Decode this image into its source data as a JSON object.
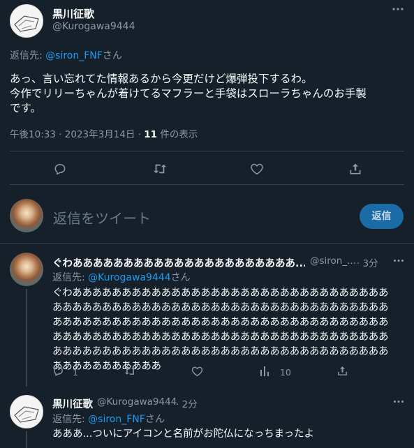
{
  "main_tweet": {
    "display_name": "黒川征歌",
    "handle": "@Kurogawa9444",
    "reply_to_prefix": "返信先: ",
    "reply_to_handle": "@siron_FNF",
    "reply_to_suffix": "さん",
    "text_line1": "あっ、言い忘れてた情報あるから今更だけど爆弾投下するわ。",
    "text_line2": "今作でリリーちゃんが着けてるマフラーと手袋はスローラちゃんのお手製",
    "text_line3": "です。",
    "meta_time": "午後10:33 · 2023年3月14日 · ",
    "meta_views_count": "11",
    "meta_views_label": " 件の表示"
  },
  "compose": {
    "placeholder": "返信をツイート",
    "button_label": "返信"
  },
  "reply1": {
    "display_name": "ぐわああああああああああああああああああああああ...",
    "handle": "@siron_...",
    "time": "· 3分",
    "reply_to_prefix": "返信先: ",
    "reply_to_handle": "@Kurogawa9444",
    "reply_to_suffix": "さん",
    "lines": [
      "ぐわああああああああああああああああああああああああああああああああ",
      "ああああああああああああああああああああああああああああああああああ",
      "ああああああああああああああああああああああああああああああああああ",
      "ああああああああああああああああああああああああああああああああああ",
      "ああああああああああああああああああああああああああああああああああ",
      "あああああああああああ"
    ],
    "reply_count": "1",
    "views_count": "10"
  },
  "reply2": {
    "display_name": "黒川征歌",
    "handle": "@Kurogawa9444",
    "time": "· 2分",
    "reply_to_prefix": "返信先: ",
    "reply_to_handle": "@siron_FNF",
    "reply_to_suffix": "さん",
    "text": "あああ...ついにアイコンと名前がお陀仏になっちまったよ"
  }
}
